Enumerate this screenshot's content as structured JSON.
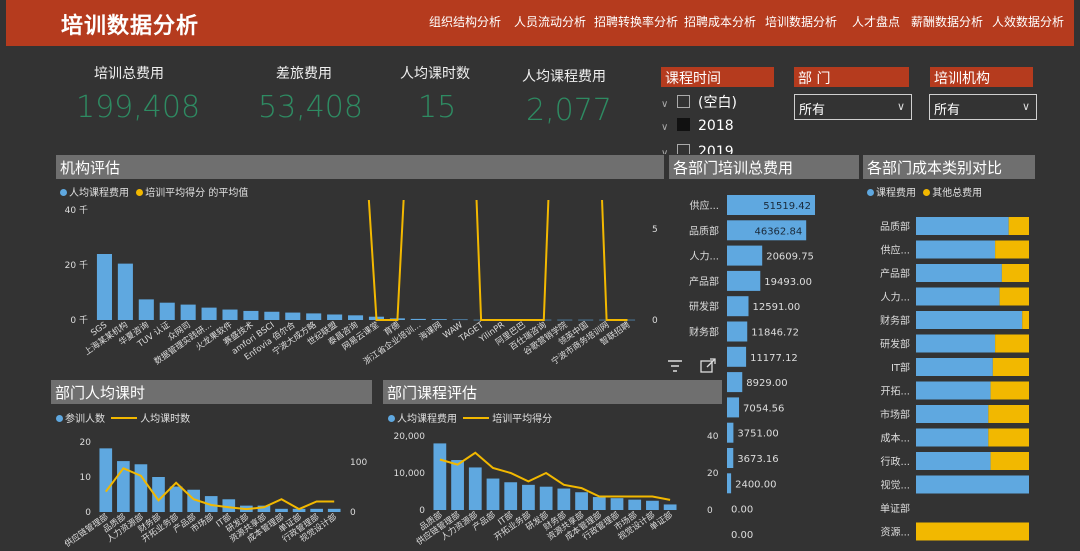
{
  "app": {
    "title": "培训数据分析"
  },
  "nav": [
    "组织结构分析",
    "人员流动分析",
    "招聘转换率分析",
    "招聘成本分析",
    "培训数据分析",
    "人才盘点",
    "薪酬数据分析",
    "人效数据分析"
  ],
  "kpis": [
    {
      "label": "培训总费用",
      "value": "199,408"
    },
    {
      "label": "差旅费用",
      "value": "53,408"
    },
    {
      "label": "人均课时数",
      "value": "15"
    },
    {
      "label": "人均课程费用",
      "value": "2,077"
    }
  ],
  "slicers": {
    "course_time": {
      "title": "课程时间",
      "items": [
        "(空白)",
        "2018",
        "2019"
      ]
    },
    "department": {
      "title": "部 门",
      "selected": "所有"
    },
    "org": {
      "title": "培训机构",
      "selected": "所有"
    }
  },
  "panels": {
    "org_eval": {
      "title": "机构评估",
      "legend_a": "人均课程费用",
      "legend_b": "培训平均得分 的平均值"
    },
    "dept_total": {
      "title": "各部门培训总费用"
    },
    "dept_cost_type": {
      "title": "各部门成本类别对比",
      "legend_a": "课程费用",
      "legend_b": "其他总费用"
    },
    "dept_hours": {
      "title": "部门人均课时",
      "legend_a": "参训人数",
      "legend_b": "人均课时数"
    },
    "dept_course": {
      "title": "部门课程评估",
      "legend_a": "人均课程费用",
      "legend_b": "培训平均得分"
    }
  },
  "colors": {
    "bar": "#5fa8e0",
    "line": "#f2b800",
    "accent": "#b53b1e",
    "kpi": "#2e8b62"
  },
  "chart_data": [
    {
      "type": "bar",
      "title": "机构评估",
      "categories": [
        "SGS",
        "上海某某机构",
        "华夏咨询",
        "TUV 认证",
        "众网司",
        "数据管理实践研...",
        "火龙果软件",
        "赛盛技术",
        "amfori BSCI",
        "Enfovia 佰尔合",
        "宁波大成方略",
        "世纪联盟",
        "泰昌咨询",
        "网易云课堂",
        "育德",
        "浙江省企业培训...",
        "海课网",
        "WAW",
        "TAGET",
        "YilinPR",
        "阿里巴巴",
        "百仕瑞咨询",
        "谷歌营销学院",
        "领英中国",
        "宁波市商务培训网",
        "智联招聘"
      ],
      "series": [
        {
          "name": "人均课程费用",
          "type": "bar",
          "values": [
            24000,
            20500,
            7500,
            6300,
            5600,
            4500,
            3800,
            3300,
            3000,
            2700,
            2400,
            2000,
            1700,
            1200,
            600,
            400,
            300,
            200,
            100,
            100,
            100,
            100,
            100,
            100,
            100,
            100
          ]
        },
        {
          "name": "培训平均得分 的平均值",
          "type": "line",
          "values": [
            28,
            30,
            32,
            34,
            28,
            34,
            36,
            32,
            32,
            34,
            28,
            34,
            18,
            0,
            0,
            22,
            30,
            30,
            0,
            0,
            0,
            0,
            30,
            30,
            0,
            0
          ]
        }
      ],
      "y_ticks_left": [
        "0 千",
        "20 千",
        "40 千"
      ],
      "y_ticks_right": [
        "0",
        "5"
      ],
      "ylim_left": [
        0,
        40000
      ],
      "ylim_right": [
        0,
        6
      ]
    },
    {
      "type": "bar",
      "title": "各部门培训总费用",
      "categories": [
        "供应...",
        "品质部",
        "人力...",
        "产品部",
        "研发部",
        "财务部",
        "",
        "",
        "",
        "",
        "",
        "",
        "",
        ""
      ],
      "values": [
        51519.42,
        46362.84,
        20609.75,
        19493.0,
        12591.0,
        11846.72,
        11177.12,
        8929.0,
        7054.56,
        3751.0,
        3673.16,
        2400.0,
        0.0,
        0.0
      ],
      "data_labels": [
        "51519.42",
        "46362.84",
        "20609.75",
        "19493.00",
        "12591.00",
        "11846.72",
        "11177.12",
        "8929.00",
        "7054.56",
        "3751.00",
        "3673.16",
        "2400.00",
        "0.00",
        "0.00"
      ]
    },
    {
      "type": "bar",
      "title": "各部门成本类别对比",
      "stacked": true,
      "categories": [
        "品质部",
        "供应...",
        "产品部",
        "人力...",
        "财务部",
        "研发部",
        "IT部",
        "开拓...",
        "市场部",
        "成本...",
        "行政...",
        "视觉...",
        "单证部",
        "资源..."
      ],
      "series": [
        {
          "name": "课程费用",
          "values": [
            82,
            70,
            76,
            74,
            94,
            70,
            68,
            66,
            64,
            64,
            66,
            100,
            0,
            0
          ]
        },
        {
          "name": "其他总费用",
          "values": [
            18,
            30,
            24,
            26,
            6,
            30,
            32,
            34,
            36,
            36,
            34,
            0,
            0,
            100
          ]
        }
      ],
      "xlim": [
        0,
        100
      ]
    },
    {
      "type": "bar",
      "title": "部门人均课时",
      "categories": [
        "供应链管理部",
        "品质部",
        "人力资源部",
        "财务部",
        "开拓业务部",
        "产品部",
        "市场部",
        "IT部",
        "研发部",
        "资源共享部",
        "成本管理部",
        "单证部",
        "行政管理部",
        "视觉设计部"
      ],
      "series": [
        {
          "name": "参训人数",
          "type": "bar",
          "values": [
            20,
            16,
            15,
            11,
            8,
            7,
            5,
            4,
            2,
            2,
            1,
            1,
            1,
            1
          ]
        },
        {
          "name": "人均课时数",
          "type": "line",
          "values": [
            35,
            75,
            62,
            20,
            50,
            22,
            12,
            8,
            5,
            8,
            22,
            5,
            18,
            18
          ]
        }
      ],
      "y_ticks_left": [
        "0",
        "10",
        "20"
      ],
      "y_ticks_right": [
        "0",
        "100"
      ],
      "ylim_left": [
        0,
        22
      ],
      "ylim_right": [
        0,
        120
      ]
    },
    {
      "type": "bar",
      "title": "部门课程评估",
      "categories": [
        "品质部",
        "供应链管理部",
        "人力资源部",
        "产品部",
        "IT部",
        "开拓业务部",
        "研发部",
        "财务部",
        "资源共享部",
        "成本管理部",
        "行政管理部",
        "市场部",
        "视觉设计部",
        "单证部"
      ],
      "series": [
        {
          "name": "人均课程费用",
          "type": "bar",
          "values": [
            18000,
            13500,
            11500,
            8500,
            7500,
            6800,
            6300,
            5800,
            4800,
            3500,
            3200,
            2800,
            2500,
            1500
          ]
        },
        {
          "name": "培训平均得分",
          "type": "line",
          "values": [
            30,
            27,
            34,
            25,
            22,
            17,
            22,
            15,
            13,
            8,
            8,
            8,
            8,
            6
          ]
        }
      ],
      "y_ticks_left": [
        "0",
        "10,000",
        "20,000"
      ],
      "y_ticks_right": [
        "0",
        "20",
        "40"
      ],
      "ylim_left": [
        0,
        20000
      ],
      "ylim_right": [
        0,
        44
      ]
    }
  ]
}
